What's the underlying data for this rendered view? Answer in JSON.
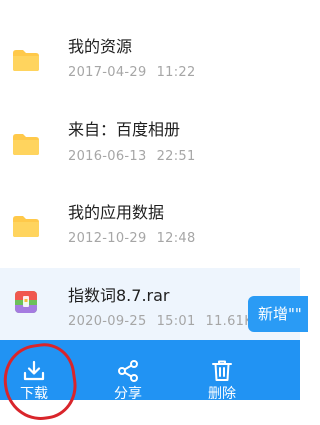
{
  "files": [
    {
      "name": "我的资源",
      "date": "2017-04-29",
      "time": "11:22",
      "size": "",
      "icon": "folder-icon"
    },
    {
      "name": "来自：百度相册",
      "date": "2016-06-13",
      "time": "22:51",
      "size": "",
      "icon": "folder-icon"
    },
    {
      "name": "我的应用数据",
      "date": "2012-10-29",
      "time": "12:48",
      "size": "",
      "icon": "folder-icon"
    },
    {
      "name": "指数词8.7.rar",
      "date": "2020-09-25",
      "time": "15:01",
      "size": "11.61K",
      "icon": "rar-archive-icon"
    }
  ],
  "floating": {
    "new_label": "新增\"\""
  },
  "toolbar": {
    "download_label": "下载",
    "share_label": "分享",
    "delete_label": "删除"
  },
  "colors": {
    "toolbar_bg": "#2193f3",
    "folder": "#ffc94a",
    "selected_row": "#eef5fd",
    "annotation_ring": "#d9252b"
  }
}
